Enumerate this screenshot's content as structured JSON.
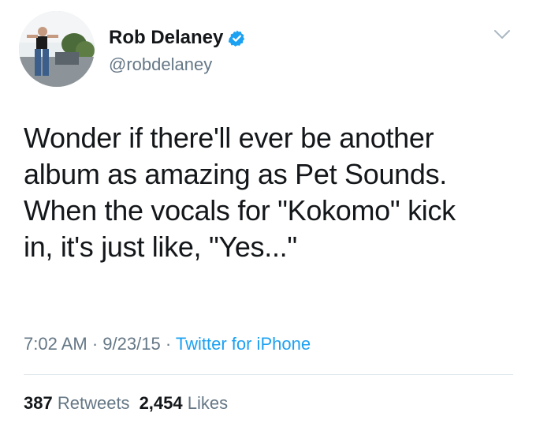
{
  "author": {
    "display_name": "Rob Delaney",
    "handle": "@robdelaney",
    "verified": true,
    "avatar_icon": "user-avatar-photo"
  },
  "menu": {
    "icon": "chevron-down-icon"
  },
  "tweet": {
    "lines": [
      "Wonder if there'll ever be another",
      "album as amazing as Pet Sounds.",
      "When the vocals for \"Kokomo\" kick",
      "in, it's just like, \"Yes...\""
    ],
    "time": "7:02 AM",
    "date": "9/23/15",
    "separator": "·",
    "source": "Twitter for iPhone"
  },
  "stats": {
    "retweets_count": "387",
    "retweets_label": "Retweets",
    "likes_count": "2,454",
    "likes_label": "Likes"
  },
  "colors": {
    "text": "#14171a",
    "secondary": "#657786",
    "link": "#1da1f2",
    "verified": "#1da1f2",
    "divider": "#e1e8ed"
  }
}
